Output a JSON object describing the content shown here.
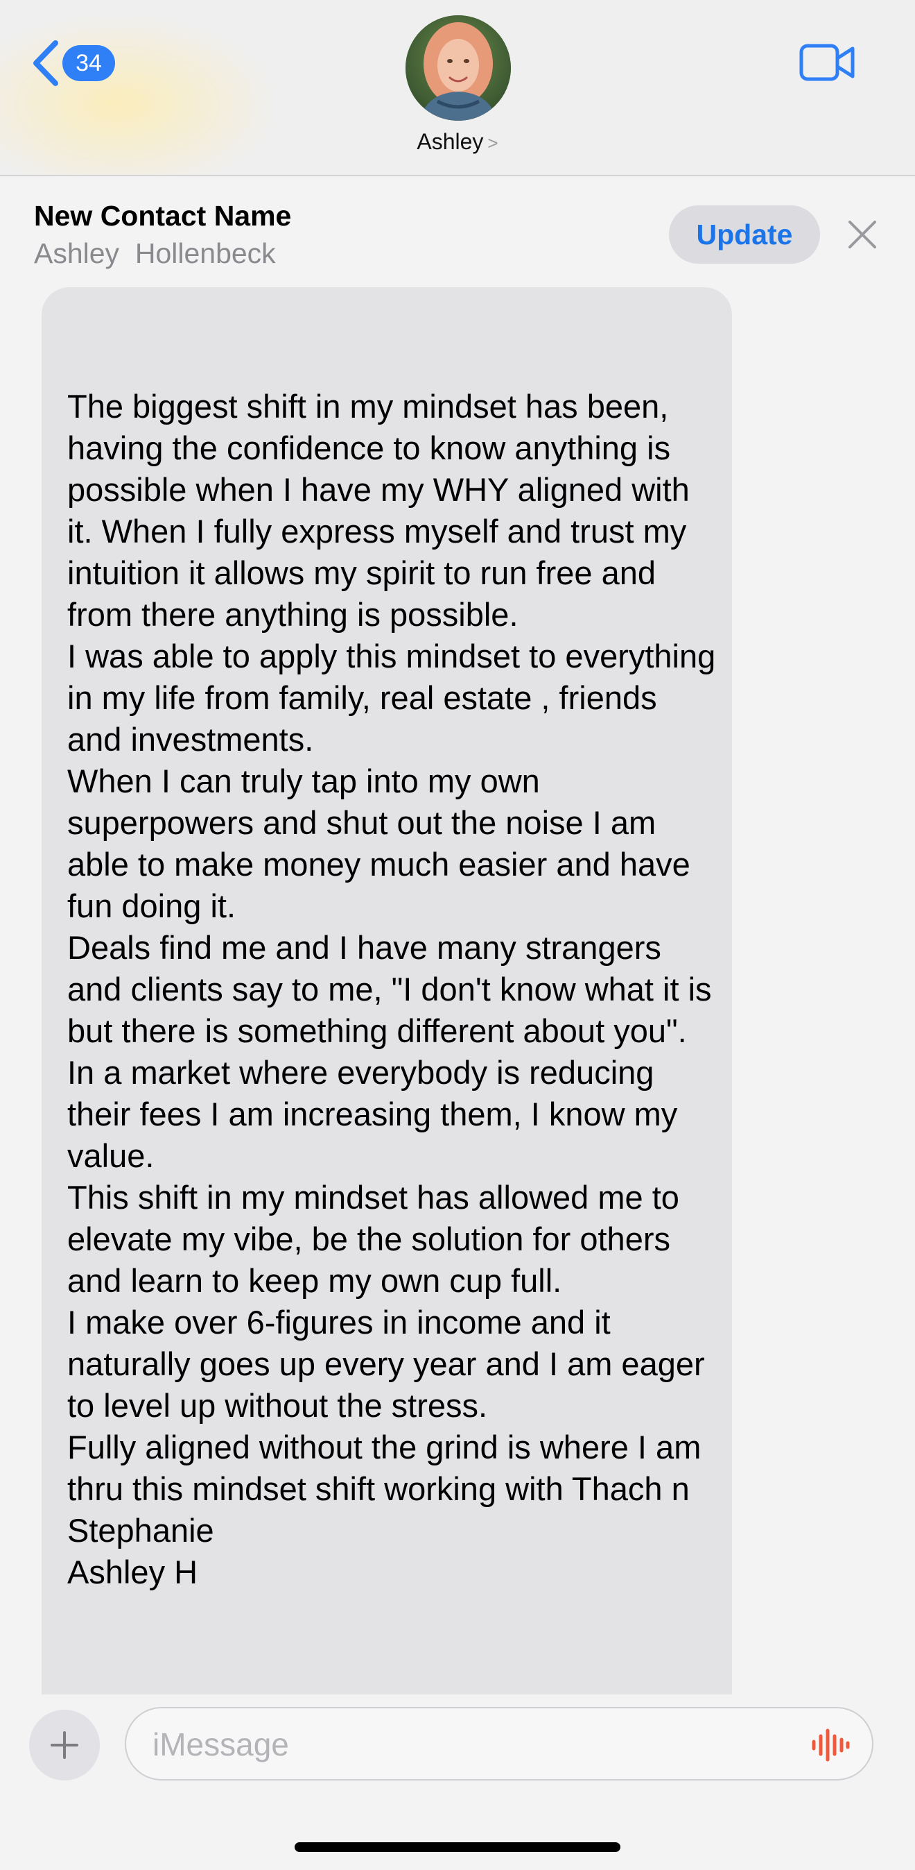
{
  "header": {
    "back_count": "34",
    "contact_name": "Ashley",
    "chevron": ">"
  },
  "banner": {
    "title": "New Contact Name",
    "subtitle": "Ashley  Hollenbeck",
    "update_label": "Update"
  },
  "message": {
    "paragraphs": [
      "The biggest shift in my mindset has been, having the confidence to know anything is possible when I have my WHY aligned with it. When I fully express myself and trust my intuition it allows my spirit to run free and from there anything is possible.",
      "I was able to apply this mindset to everything in my life from family, real estate , friends and investments.",
      "When I can truly tap into my own superpowers and shut out the noise I am able to make money much easier and have fun doing it.",
      "Deals find me and I have many strangers and clients say to me, \"I don't know what it is but there is something different about you\". In a market where everybody is reducing their fees I am increasing them, I know my value.",
      "This shift in my mindset has allowed me to elevate my vibe, be the solution for others and learn to keep my own cup full.",
      "I make over 6-figures in income and it naturally goes up every year and I am eager to level up without the stress.",
      "Fully aligned without the grind is where I am thru this mindset shift working with Thach n Stephanie",
      "Ashley H"
    ]
  },
  "input": {
    "placeholder": "iMessage"
  },
  "colors": {
    "accent": "#2f7ff6",
    "update_text": "#1c74e9",
    "audio_icon": "#f05a3c"
  },
  "icons": {
    "back": "chevron-left-icon",
    "video": "video-camera-icon",
    "close": "close-icon",
    "plus": "plus-icon",
    "audio": "audio-waveform-icon"
  }
}
